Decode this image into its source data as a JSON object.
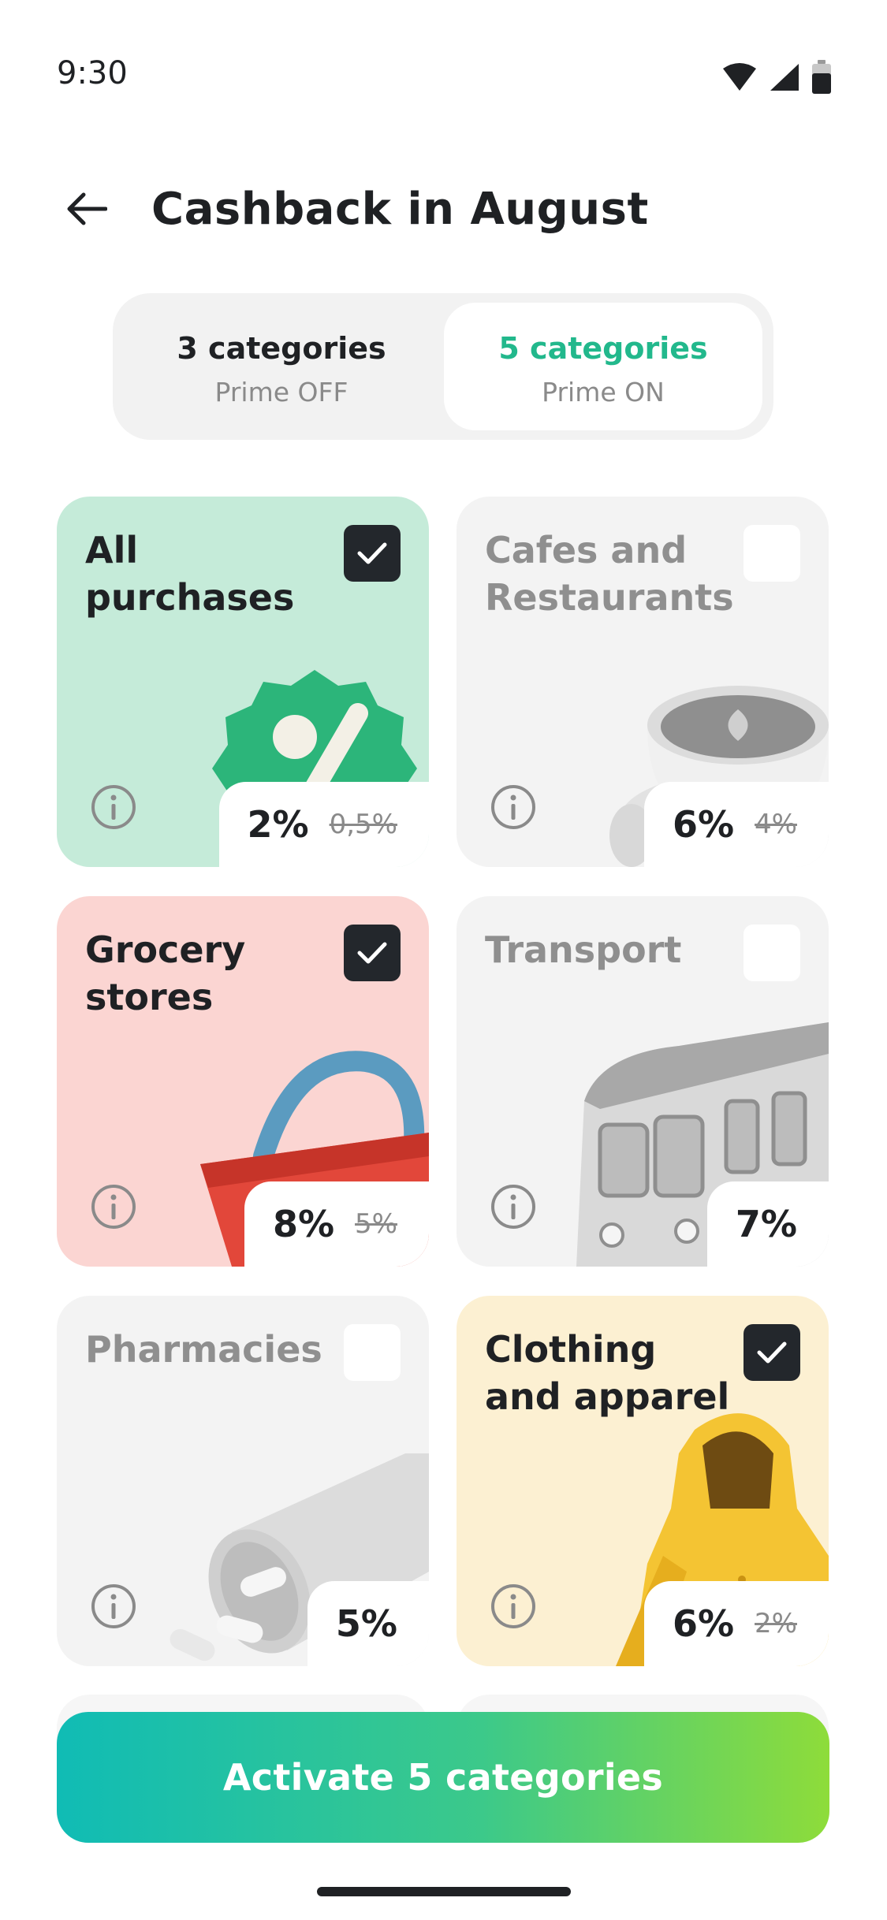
{
  "status_bar": {
    "time": "9:30",
    "icons": [
      "wifi-icon",
      "cellular-signal-icon",
      "battery-icon"
    ]
  },
  "header": {
    "back_icon": "arrow-left-icon",
    "title": "Cashback in August"
  },
  "segment": {
    "options": [
      {
        "title": "3 categories",
        "subtitle": "Prime OFF",
        "selected": false
      },
      {
        "title": "5 categories",
        "subtitle": "Prime ON",
        "selected": true
      }
    ]
  },
  "categories": [
    {
      "title": "All purchases",
      "rate": "2%",
      "old_rate": "0,5%",
      "checked": true,
      "theme": "green",
      "illustration": "percent-badge-icon"
    },
    {
      "title": "Cafes and Restaurants",
      "rate": "6%",
      "old_rate": "4%",
      "checked": false,
      "theme": "grey",
      "illustration": "coffee-cup-icon"
    },
    {
      "title": "Grocery stores",
      "rate": "8%",
      "old_rate": "5%",
      "checked": true,
      "theme": "pink",
      "illustration": "shopping-basket-icon"
    },
    {
      "title": "Transport",
      "rate": "7%",
      "old_rate": "",
      "checked": false,
      "theme": "grey",
      "illustration": "train-icon"
    },
    {
      "title": "Pharmacies",
      "rate": "5%",
      "old_rate": "",
      "checked": false,
      "theme": "grey",
      "illustration": "pill-bottle-icon"
    },
    {
      "title": "Clothing and apparel",
      "rate": "6%",
      "old_rate": "2%",
      "checked": true,
      "theme": "yellow",
      "illustration": "hoodie-icon"
    }
  ],
  "cta": {
    "label": "Activate 5 categories",
    "gradient": [
      "#10bcb5",
      "#8edc3a"
    ]
  },
  "colors": {
    "accent": "#22b88c",
    "checkbox_on": "#23272c"
  }
}
